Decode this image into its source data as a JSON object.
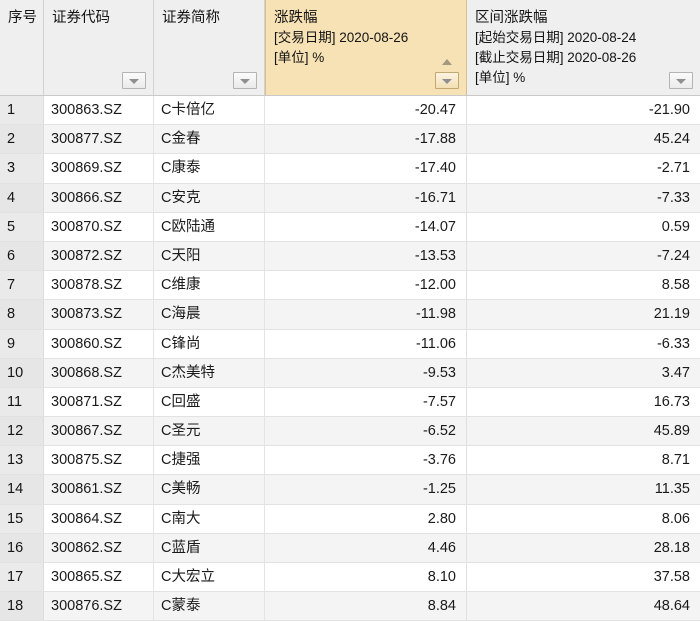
{
  "table": {
    "columns": [
      {
        "key": "index",
        "header_lines": [
          "序号"
        ],
        "sorted": false,
        "has_filter": false
      },
      {
        "key": "code",
        "header_lines": [
          "证券代码"
        ],
        "sorted": false,
        "has_filter": true
      },
      {
        "key": "name",
        "header_lines": [
          "证券简称"
        ],
        "sorted": false,
        "has_filter": true
      },
      {
        "key": "pct",
        "header_lines": [
          "涨跌幅",
          "[交易日期] 2020-08-26",
          "[单位] %"
        ],
        "sorted": true,
        "has_filter": true
      },
      {
        "key": "range",
        "header_lines": [
          "区间涨跌幅",
          "[起始交易日期] 2020-08-24",
          "[截止交易日期] 2020-08-26",
          "[单位] %"
        ],
        "sorted": false,
        "has_filter": true
      }
    ],
    "sort_direction": "ascending",
    "sorted_column_color": "#f7e2b5",
    "rows": [
      {
        "index": "1",
        "code": "300863.SZ",
        "name": "C卡倍亿",
        "pct": "-20.47",
        "range": "-21.90"
      },
      {
        "index": "2",
        "code": "300877.SZ",
        "name": "C金春",
        "pct": "-17.88",
        "range": "45.24"
      },
      {
        "index": "3",
        "code": "300869.SZ",
        "name": "C康泰",
        "pct": "-17.40",
        "range": "-2.71"
      },
      {
        "index": "4",
        "code": "300866.SZ",
        "name": "C安克",
        "pct": "-16.71",
        "range": "-7.33"
      },
      {
        "index": "5",
        "code": "300870.SZ",
        "name": "C欧陆通",
        "pct": "-14.07",
        "range": "0.59"
      },
      {
        "index": "6",
        "code": "300872.SZ",
        "name": "C天阳",
        "pct": "-13.53",
        "range": "-7.24"
      },
      {
        "index": "7",
        "code": "300878.SZ",
        "name": "C维康",
        "pct": "-12.00",
        "range": "8.58"
      },
      {
        "index": "8",
        "code": "300873.SZ",
        "name": "C海晨",
        "pct": "-11.98",
        "range": "21.19"
      },
      {
        "index": "9",
        "code": "300860.SZ",
        "name": "C锋尚",
        "pct": "-11.06",
        "range": "-6.33"
      },
      {
        "index": "10",
        "code": "300868.SZ",
        "name": "C杰美特",
        "pct": "-9.53",
        "range": "3.47"
      },
      {
        "index": "11",
        "code": "300871.SZ",
        "name": "C回盛",
        "pct": "-7.57",
        "range": "16.73"
      },
      {
        "index": "12",
        "code": "300867.SZ",
        "name": "C圣元",
        "pct": "-6.52",
        "range": "45.89"
      },
      {
        "index": "13",
        "code": "300875.SZ",
        "name": "C捷强",
        "pct": "-3.76",
        "range": "8.71"
      },
      {
        "index": "14",
        "code": "300861.SZ",
        "name": "C美畅",
        "pct": "-1.25",
        "range": "11.35"
      },
      {
        "index": "15",
        "code": "300864.SZ",
        "name": "C南大",
        "pct": "2.80",
        "range": "8.06"
      },
      {
        "index": "16",
        "code": "300862.SZ",
        "name": "C蓝盾",
        "pct": "4.46",
        "range": "28.18"
      },
      {
        "index": "17",
        "code": "300865.SZ",
        "name": "C大宏立",
        "pct": "8.10",
        "range": "37.58"
      },
      {
        "index": "18",
        "code": "300876.SZ",
        "name": "C蒙泰",
        "pct": "8.84",
        "range": "48.64"
      }
    ]
  }
}
